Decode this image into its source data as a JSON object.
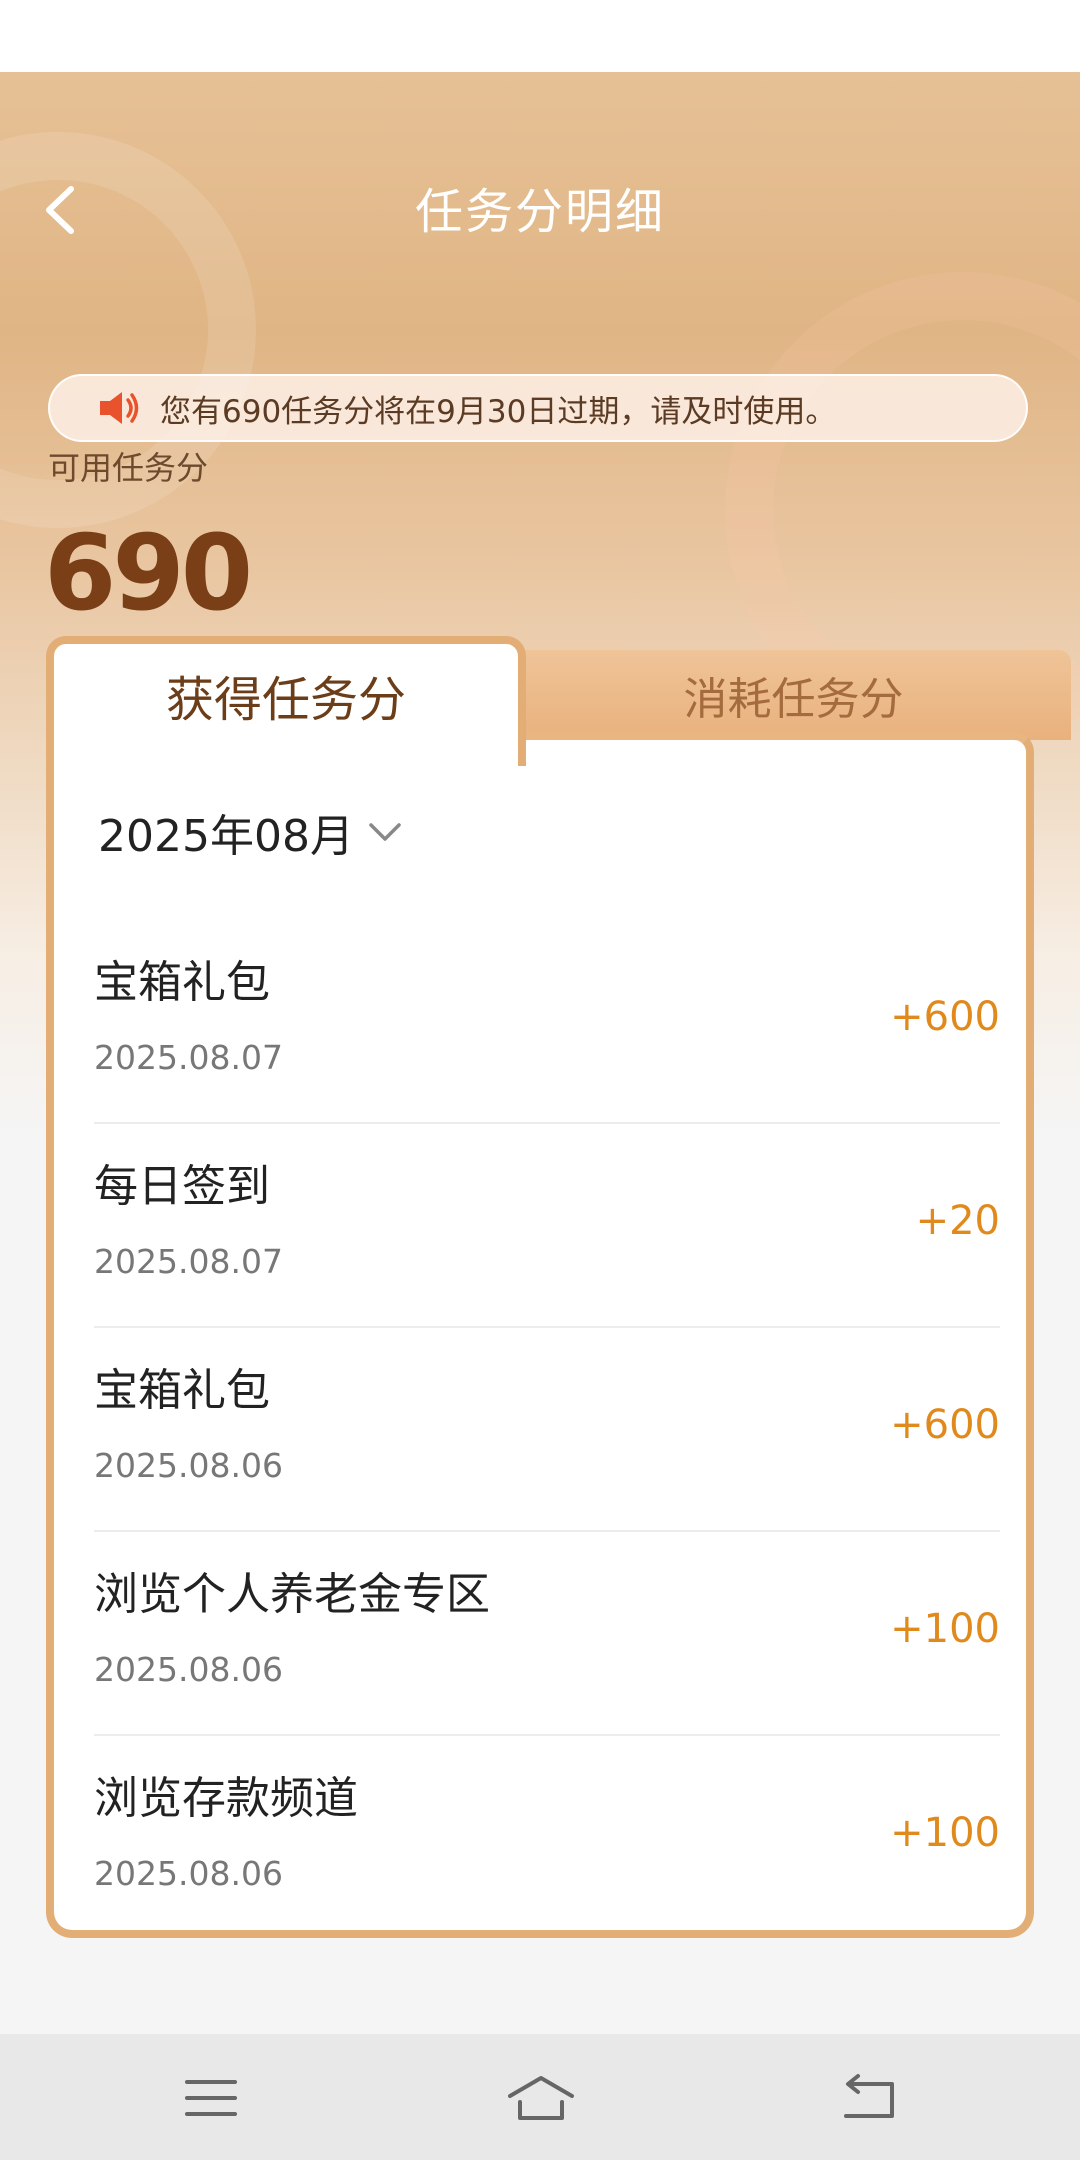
{
  "header": {
    "title": "任务分明细"
  },
  "notice": {
    "text": "您有690任务分将在9月30日过期，请及时使用。"
  },
  "summary": {
    "label": "可用任务分",
    "value": "690"
  },
  "tabs": [
    {
      "label": "获得任务分",
      "active": true
    },
    {
      "label": "消耗任务分",
      "active": false
    }
  ],
  "filter": {
    "month": "2025年08月"
  },
  "records": [
    {
      "title": "宝箱礼包",
      "date": "2025.08.07",
      "points": "+600"
    },
    {
      "title": "每日签到",
      "date": "2025.08.07",
      "points": "+20"
    },
    {
      "title": "宝箱礼包",
      "date": "2025.08.06",
      "points": "+600"
    },
    {
      "title": "浏览个人养老金专区",
      "date": "2025.08.06",
      "points": "+100"
    },
    {
      "title": "浏览存款频道",
      "date": "2025.08.06",
      "points": "+100"
    }
  ],
  "colors": {
    "accent": "#e08a1e",
    "tab_border": "#e3ad76",
    "title_brown": "#7a3f16"
  },
  "icons": {
    "back": "chevron-left-icon",
    "notice": "speaker-icon",
    "dropdown": "chevron-down-icon",
    "nav": [
      "menu-icon",
      "home-icon",
      "back-arrow-icon"
    ]
  }
}
